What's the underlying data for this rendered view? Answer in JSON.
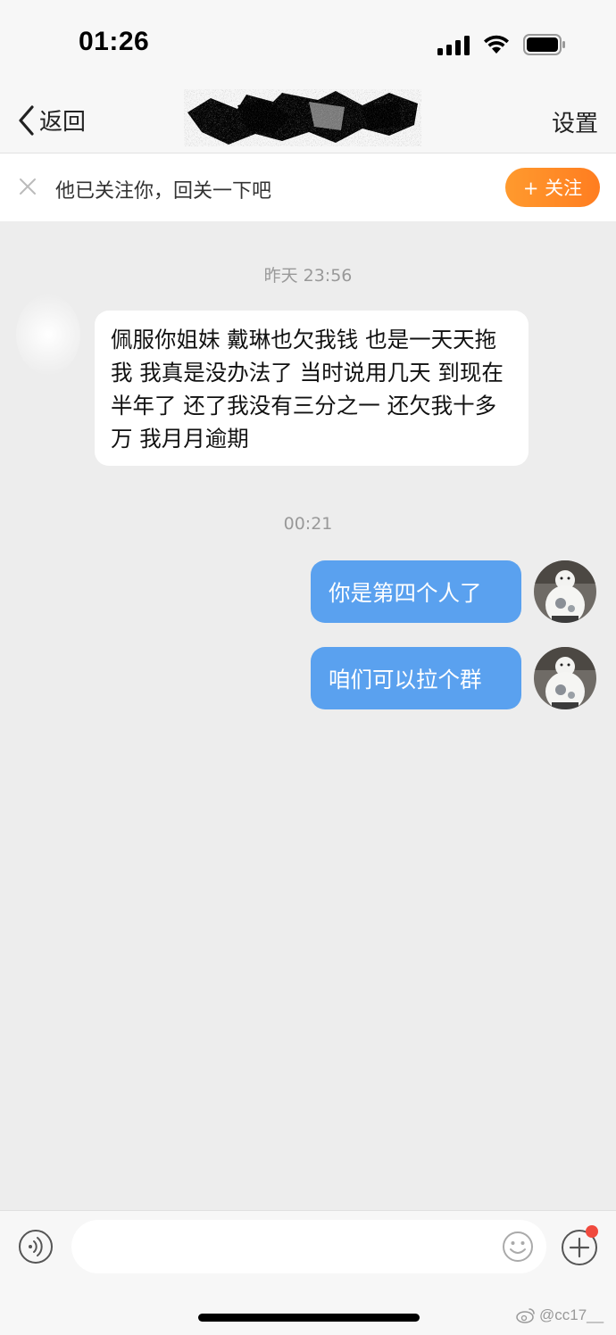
{
  "status_bar": {
    "time": "01:26"
  },
  "nav": {
    "back_label": "返回",
    "settings_label": "设置"
  },
  "follow_banner": {
    "text": "他已关注你，回关一下吧",
    "follow_button": "+ 关注"
  },
  "messages": [
    {
      "type": "timestamp",
      "text": "昨天 23:56"
    },
    {
      "type": "incoming",
      "text": "佩服你姐妹 戴琳也欠我钱 也是一天天拖我 我真是没办法了 当时说用几天 到现在半年了 还了我没有三分之一 还欠我十多万 我月月逾期"
    },
    {
      "type": "timestamp",
      "text": "00:21"
    },
    {
      "type": "outgoing",
      "text": "你是第四个人了"
    },
    {
      "type": "outgoing",
      "text": "咱们可以拉个群"
    }
  ],
  "input_bar": {
    "placeholder": ""
  },
  "watermark": {
    "text": "@cc17__"
  },
  "colors": {
    "outgoing_bubble": "#5aa1ef",
    "follow_button": "#ff8a25",
    "background": "#ededed"
  }
}
